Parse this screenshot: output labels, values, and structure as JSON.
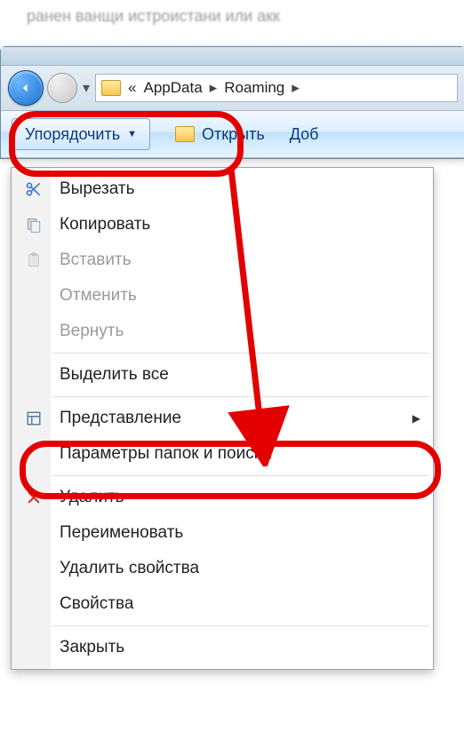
{
  "breadcrumb": {
    "prefix": "«",
    "segments": [
      "AppData",
      "Roaming"
    ]
  },
  "toolbar": {
    "organize_label": "Упорядочить",
    "open_label": "Открыть",
    "add_label": "Доб"
  },
  "menu": {
    "cut": "Вырезать",
    "copy": "Копировать",
    "paste": "Вставить",
    "undo": "Отменить",
    "redo": "Вернуть",
    "select_all": "Выделить все",
    "layout": "Представление",
    "folder_options": "Параметры папок и поиска",
    "delete": "Удалить",
    "rename": "Переименовать",
    "remove_props": "Удалить свойства",
    "properties": "Свойства",
    "close": "Закрыть"
  },
  "annotations": {
    "highlight_color": "#e30000"
  }
}
